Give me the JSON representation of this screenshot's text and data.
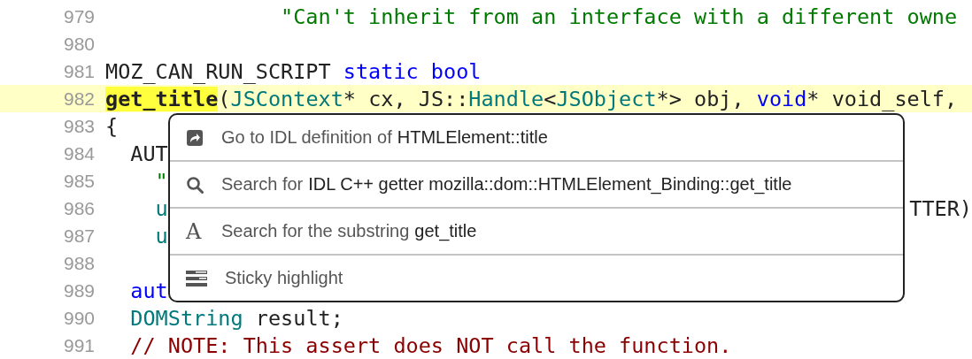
{
  "code": {
    "lines": [
      {
        "number": "979",
        "highlighted": false,
        "tokens": [
          {
            "kind": "string",
            "text": "              \"Can't inherit from an interface with a different owne"
          }
        ]
      },
      {
        "number": "980",
        "highlighted": false
      },
      {
        "number": "981",
        "highlighted": false,
        "tokens": [
          {
            "kind": "plain",
            "text": "MOZ_CAN_RUN_SCRIPT "
          },
          {
            "kind": "keyword",
            "text": "static bool"
          }
        ]
      },
      {
        "number": "982",
        "highlighted": true,
        "tokens": [
          {
            "kind": "match",
            "text": "get_title"
          },
          {
            "kind": "plain",
            "text": "("
          },
          {
            "kind": "type",
            "text": "JSContext"
          },
          {
            "kind": "plain",
            "text": "* cx, JS::"
          },
          {
            "kind": "type",
            "text": "Handle"
          },
          {
            "kind": "plain",
            "text": "<"
          },
          {
            "kind": "type",
            "text": "JSObject"
          },
          {
            "kind": "plain",
            "text": "*> obj, "
          },
          {
            "kind": "keyword",
            "text": "void"
          },
          {
            "kind": "plain",
            "text": "* void_self,"
          }
        ]
      },
      {
        "number": "983",
        "highlighted": false,
        "tokens": [
          {
            "kind": "plain",
            "text": "{"
          }
        ]
      },
      {
        "number": "984",
        "highlighted": false,
        "tokens": [
          {
            "kind": "plain",
            "text": "  AUT"
          }
        ]
      },
      {
        "number": "985",
        "highlighted": false,
        "tokens": [
          {
            "kind": "string",
            "text": "    \""
          }
        ]
      },
      {
        "number": "986",
        "highlighted": false,
        "tokens": [
          {
            "kind": "type",
            "text": "    u"
          },
          {
            "kind": "right",
            "text": "TTER)"
          }
        ]
      },
      {
        "number": "987",
        "highlighted": false,
        "tokens": [
          {
            "kind": "type",
            "text": "    u"
          }
        ]
      },
      {
        "number": "988",
        "highlighted": false
      },
      {
        "number": "989",
        "highlighted": false,
        "tokens": [
          {
            "kind": "keyword",
            "text": "  aut"
          }
        ]
      },
      {
        "number": "990",
        "highlighted": false,
        "tokens": [
          {
            "kind": "type",
            "text": "  DOMString"
          },
          {
            "kind": "plain",
            "text": " result;"
          }
        ]
      },
      {
        "number": "991",
        "highlighted": false,
        "tokens": [
          {
            "kind": "comment",
            "text": "  // NOTE: This assert does NOT call the function."
          }
        ]
      }
    ]
  },
  "context_menu": {
    "items": [
      {
        "kind": "goto",
        "label": "Go to IDL definition of",
        "target": "HTMLElement::title"
      },
      {
        "kind": "search",
        "label": "Search for",
        "target": "IDL C++ getter mozilla::dom::HTMLElement_Binding::get_title"
      },
      {
        "kind": "text",
        "glyph": "A",
        "label": "Search for the substring",
        "target": "get_title"
      },
      {
        "kind": "sticky",
        "label": "Sticky highlight"
      }
    ]
  }
}
